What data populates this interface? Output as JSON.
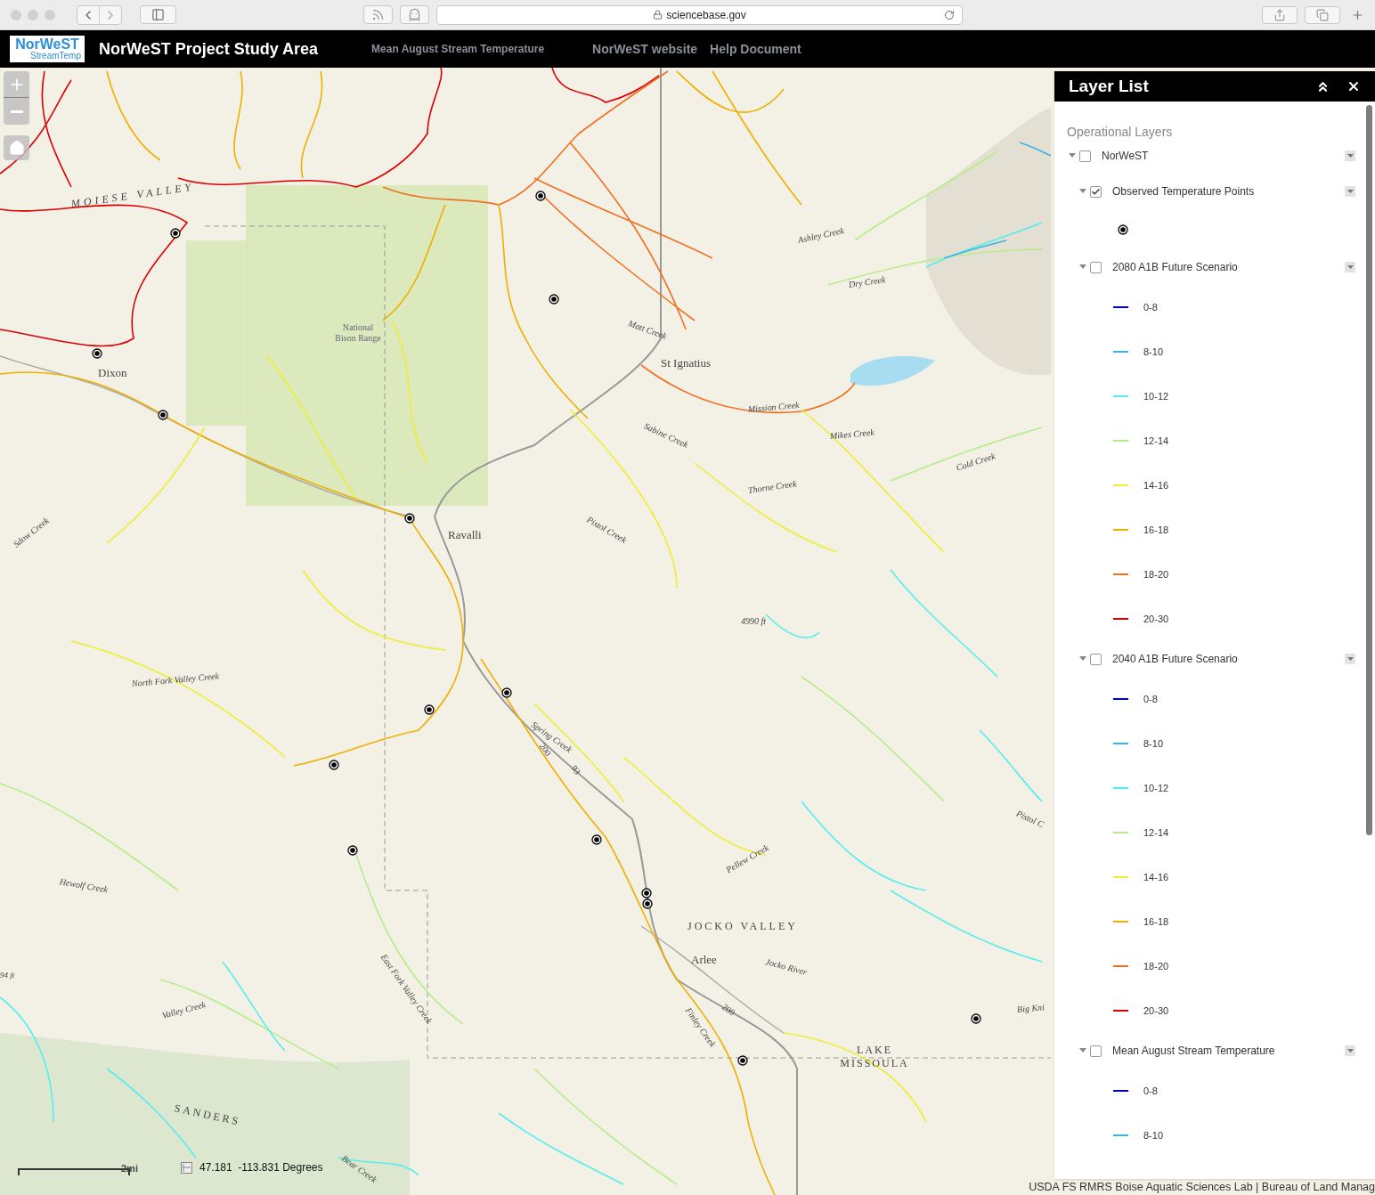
{
  "browser": {
    "url": "sciencebase.gov"
  },
  "header": {
    "logo_top": "NorWeST",
    "logo_bottom": "StreamTemp",
    "title": "NorWeST Project Study Area",
    "links": [
      "Mean August Stream Temperature",
      "NorWeST website",
      "Help Document"
    ]
  },
  "map": {
    "labels": [
      "MOIESE VALLEY",
      "National Bison Range",
      "Dixon",
      "Ashley Creek",
      "Dry Creek",
      "Matt Creek",
      "St Ignatius",
      "Mission Creek",
      "Sabine Creek",
      "Mikes Creek",
      "Cold Creek",
      "Thorne Creek",
      "Pistol Creek",
      "Ravalli",
      "Sdow Creek",
      "4990 ft",
      "North Fork Valley Creek",
      "Spring Creek",
      "200",
      "93",
      "Pistol C",
      "Pellew Creek",
      "Hewolf Creek",
      "JOCKO VALLEY",
      "Arlee",
      "Jocko River",
      "East Fork Valley Creek",
      "Valley Creek",
      "Finley Creek",
      "200",
      "Big Kni",
      "LAKE MISSOULA",
      "SANDERS",
      "Bear Creek",
      "94 ft"
    ],
    "scale_label": "2mi",
    "coordinates": "47.181  -113.831 Degrees",
    "attribution": "USDA FS RMRS Boise Aquatic Sciences Lab | Bureau of Land Manag"
  },
  "layer_list": {
    "title": "Layer List",
    "section": "Operational Layers",
    "layers": [
      {
        "name": "NorWeST",
        "checked": false,
        "expanded": true,
        "children": [
          {
            "name": "Observed Temperature Points",
            "checked": true,
            "expanded": true,
            "kind": "points"
          },
          {
            "name": "2080 A1B Future Scenario",
            "checked": false,
            "expanded": true,
            "kind": "classes",
            "classes": [
              {
                "label": "0-8",
                "color": "#0000cc"
              },
              {
                "label": "8-10",
                "color": "#33b5e5"
              },
              {
                "label": "10-12",
                "color": "#55eeee"
              },
              {
                "label": "12-14",
                "color": "#b5ee88"
              },
              {
                "label": "14-16",
                "color": "#eeee33"
              },
              {
                "label": "16-18",
                "color": "#f0b000"
              },
              {
                "label": "18-20",
                "color": "#f07020"
              },
              {
                "label": "20-30",
                "color": "#dd0000"
              }
            ]
          },
          {
            "name": "2040 A1B Future Scenario",
            "checked": false,
            "expanded": true,
            "kind": "classes",
            "classes": [
              {
                "label": "0-8",
                "color": "#0000cc"
              },
              {
                "label": "8-10",
                "color": "#33b5e5"
              },
              {
                "label": "10-12",
                "color": "#55eeee"
              },
              {
                "label": "12-14",
                "color": "#b5ee88"
              },
              {
                "label": "14-16",
                "color": "#eeee33"
              },
              {
                "label": "16-18",
                "color": "#f0b000"
              },
              {
                "label": "18-20",
                "color": "#f07020"
              },
              {
                "label": "20-30",
                "color": "#dd0000"
              }
            ]
          },
          {
            "name": "Mean August Stream Temperature",
            "checked": false,
            "expanded": true,
            "kind": "classes",
            "classes": [
              {
                "label": "0-8",
                "color": "#0000cc"
              },
              {
                "label": "8-10",
                "color": "#33b5e5"
              }
            ]
          }
        ]
      }
    ]
  }
}
